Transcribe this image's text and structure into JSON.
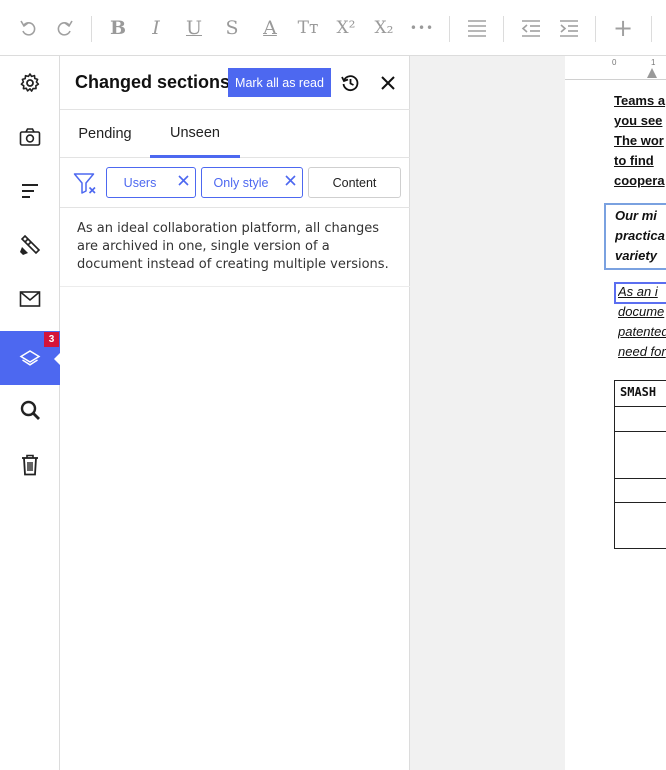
{
  "toolbar": {
    "tools": [
      "undo",
      "redo",
      "bold",
      "italic",
      "underline",
      "strikethrough",
      "font-color",
      "text-size",
      "superscript",
      "subscript",
      "more",
      "align",
      "outdent",
      "indent",
      "insert"
    ],
    "bold_glyph": "B",
    "italic_glyph": "I",
    "underline_glyph": "U",
    "strike_glyph": "S",
    "fontcolor_glyph": "A",
    "textsize_glyph": "Tт",
    "superscript_glyph": "X²",
    "subscript_glyph": "X₂",
    "more_glyph": "•••",
    "insert_glyph": "+"
  },
  "sidebar": {
    "items": [
      {
        "icon": "gear-icon"
      },
      {
        "icon": "camera-icon"
      },
      {
        "icon": "outline-icon"
      },
      {
        "icon": "paint-brush-icon"
      },
      {
        "icon": "envelope-icon"
      },
      {
        "icon": "layers-icon",
        "badge": "3",
        "active": true
      },
      {
        "icon": "search-icon"
      },
      {
        "icon": "trash-icon"
      }
    ],
    "badge_count": "3"
  },
  "panel": {
    "title": "Changed sections",
    "mark_all_label": "Mark all as read",
    "tabs": [
      {
        "label": "Pending",
        "active": false
      },
      {
        "label": "Unseen",
        "active": true
      }
    ],
    "filters": {
      "users_label": "Users",
      "only_style_label": "Only style",
      "content_label": "Content"
    },
    "items": [
      {
        "text": "As an ideal collaboration platform, all changes are archived in one, single version of a document instead of creating multiple versions."
      }
    ]
  },
  "document": {
    "ruler": {
      "mark0": "0",
      "mark1": "1"
    },
    "para1": [
      "Teams a",
      "you see",
      "The wor",
      "to find",
      "coopera"
    ],
    "para2": [
      "Our mi",
      "practica",
      "variety"
    ],
    "para3": [
      "As an i",
      "docume",
      "patented",
      "need for"
    ],
    "table_header": "SMASH",
    "colors": {
      "accent": "#4d68f0",
      "badge": "#d4143a"
    }
  }
}
